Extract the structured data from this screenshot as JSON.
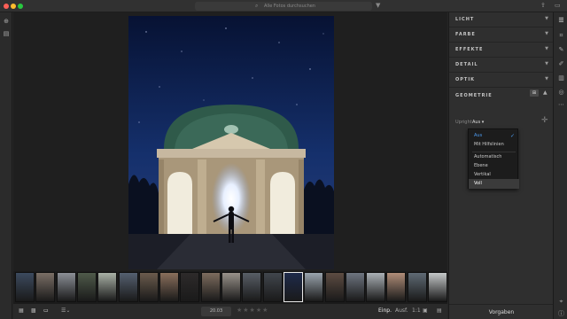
{
  "window": {
    "search_placeholder": "Alle Fotos durchsuchen",
    "icons": [
      "search-icon",
      "filter-icon",
      "share-icon",
      "panel-icon"
    ]
  },
  "left_toolbar": {
    "icons": [
      "add-photos-icon",
      "library-icon"
    ]
  },
  "right_panel": {
    "sections": [
      {
        "label": "LICHT"
      },
      {
        "label": "FARBE"
      },
      {
        "label": "EFFEKTE"
      },
      {
        "label": "DETAIL"
      },
      {
        "label": "OPTIK"
      },
      {
        "label": "GEOMETRIE"
      }
    ],
    "upright": {
      "label": "Upright",
      "value": "Aus",
      "options": [
        {
          "label": "Aus",
          "selected": true
        },
        {
          "label": "Mit Hilfslinien",
          "selected": false
        },
        {
          "label": "Automatisch",
          "selected": false
        },
        {
          "label": "Ebene",
          "selected": false
        },
        {
          "label": "Vertikal",
          "selected": false
        },
        {
          "label": "Voll",
          "selected": false,
          "hover": true
        }
      ],
      "check_glyph": "✓"
    },
    "presets_label": "Vorgaben"
  },
  "filmstrip": {
    "thumb_count": 21,
    "selected_index": 13
  },
  "bottom_bar": {
    "date": "20.03",
    "stars": "★★★★★",
    "fit_label": "Einp.",
    "fill_label": "Ausf.",
    "ratio_label": "1:1"
  },
  "colors": {
    "accent": "#4d9bf0",
    "panel_bg": "#2f2f2f",
    "canvas_bg": "#1f1f1f"
  }
}
